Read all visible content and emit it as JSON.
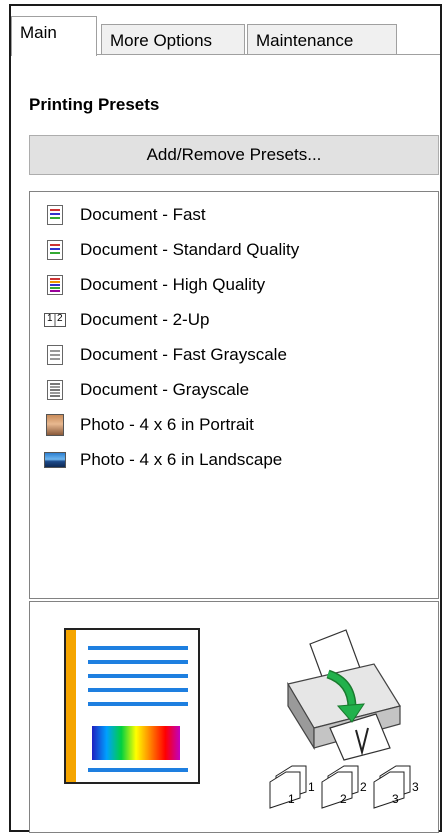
{
  "tabs": {
    "main": "Main",
    "more_options": "More Options",
    "maintenance": "Maintenance"
  },
  "presets": {
    "heading": "Printing Presets",
    "add_remove_label": "Add/Remove Presets...",
    "items": [
      {
        "label": "Document - Fast",
        "icon": "document-color-icon"
      },
      {
        "label": "Document - Standard Quality",
        "icon": "document-color-icon"
      },
      {
        "label": "Document - High Quality",
        "icon": "document-high-quality-icon"
      },
      {
        "label": "Document - 2-Up",
        "icon": "two-up-icon"
      },
      {
        "label": "Document - Fast Grayscale",
        "icon": "document-gray-icon"
      },
      {
        "label": "Document - Grayscale",
        "icon": "document-gray-icon"
      },
      {
        "label": "Photo - 4 x 6 in Portrait",
        "icon": "photo-portrait-icon"
      },
      {
        "label": "Photo - 4 x 6 in Landscape",
        "icon": "photo-landscape-icon"
      }
    ]
  },
  "preview": {
    "two_up_digits": [
      "1",
      "2"
    ],
    "copy_numbers": [
      "1",
      "1",
      "2",
      "2",
      "3",
      "3"
    ]
  },
  "colors": {
    "accent_orange": "#f5a500",
    "line_blue": "#1e7fe0",
    "arrow_green": "#22b14c"
  }
}
